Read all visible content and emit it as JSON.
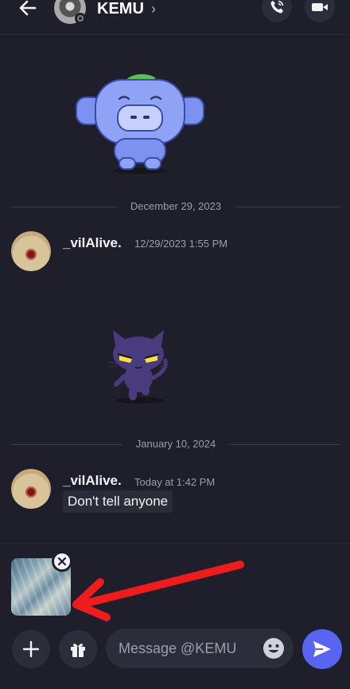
{
  "header": {
    "title": "KEMU",
    "chevron": "›",
    "back_icon": "arrow-left-icon",
    "call_icon": "phone-call-icon",
    "video_icon": "video-camera-icon"
  },
  "messages": [
    {
      "divider_date": "December 29, 2023",
      "author": "_vilAlive.",
      "timestamp": "12/29/2023 1:55 PM",
      "sticker": "cat-sticker"
    },
    {
      "divider_date": "January 10, 2024",
      "author": "_vilAlive.",
      "timestamp": "Today at 1:42 PM",
      "text": "Don't tell anyone"
    }
  ],
  "composer": {
    "placeholder": "Message @KEMU",
    "attachment_remove": "×",
    "accent": "#5865f2",
    "annotation_color": "#ee1c1c"
  }
}
